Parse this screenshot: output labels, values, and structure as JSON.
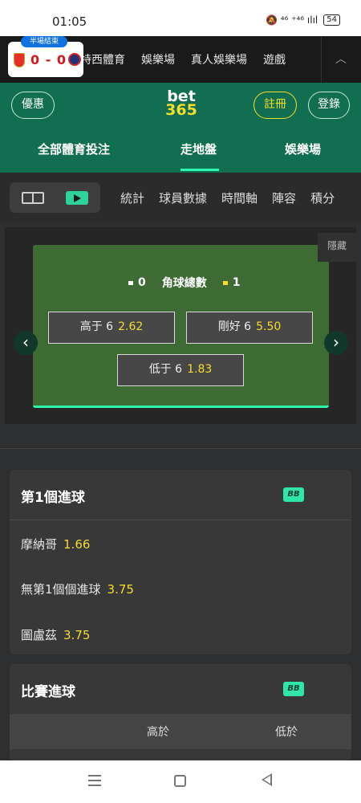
{
  "status_bar": {
    "time": "01:05",
    "icons_text": "🔕 ⁴⁶ ⁺⁴⁶ ılıl",
    "battery": "54"
  },
  "top_nav": {
    "items": [
      "特西體育",
      "娛樂場",
      "真人娛樂場",
      "遊戲"
    ],
    "collapse_icon": "chevron-up-icon"
  },
  "scoreboard": {
    "badge": "半場結束",
    "score": "0 - 0"
  },
  "header": {
    "offers_label": "優惠",
    "logo_top": "bet",
    "logo_bottom": "365",
    "register_label": "註冊",
    "login_label": "登錄",
    "tabs": [
      "全部體育投注",
      "走地盤",
      "娛樂場"
    ],
    "active_tab": "走地盤"
  },
  "sub_tabs": [
    "統計",
    "球員數據",
    "時間軸",
    "陣容",
    "積分"
  ],
  "live_panel": {
    "hide_label": "隱藏",
    "home_corners": "0",
    "market_title": "角球總數",
    "away_corners": "1",
    "selections": [
      {
        "label": "高于 6",
        "odds": "2.62"
      },
      {
        "label": "剛好 6",
        "odds": "5.50"
      },
      {
        "label": "低于 6",
        "odds": "1.83"
      }
    ]
  },
  "first_goal_card": {
    "title": "第1個進球",
    "bb_label": "BB",
    "rows": [
      {
        "label": "摩納哥",
        "odds": "1.66"
      },
      {
        "label": "無第1個個進球",
        "odds": "3.75"
      },
      {
        "label": "圖盧茲",
        "odds": "3.75"
      }
    ]
  },
  "match_goals_card": {
    "title": "比賽進球",
    "bb_label": "BB",
    "col_over": "高於",
    "col_under": "低於"
  },
  "colors": {
    "brand_green": "#126e51",
    "accent": "#2ff7b0",
    "odds_yellow": "#f5de2a"
  }
}
